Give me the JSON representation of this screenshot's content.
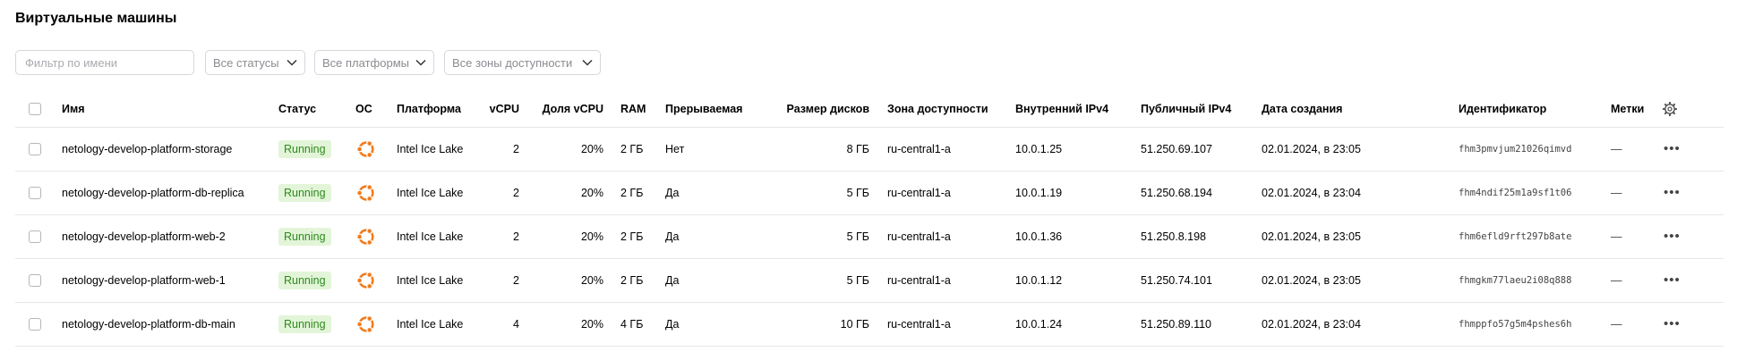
{
  "page": {
    "title": "Виртуальные машины"
  },
  "filters": {
    "name_placeholder": "Фильтр по имени",
    "status_value": "Все статусы",
    "platform_value": "Все платформы",
    "zone_value": "Все зоны доступности"
  },
  "table": {
    "columns": {
      "name": "Имя",
      "status": "Статус",
      "os": "ОС",
      "platform": "Платформа",
      "vcpu": "vCPU",
      "core_fraction": "Доля vCPU",
      "ram": "RAM",
      "preemptible": "Прерываемая",
      "disk_size": "Размер дисков",
      "zone": "Зона доступности",
      "internal_ip": "Внутренний IPv4",
      "public_ip": "Публичный IPv4",
      "created": "Дата создания",
      "id": "Идентификатор",
      "labels": "Метки"
    },
    "rows": [
      {
        "name": "netology-develop-platform-storage",
        "status": "Running",
        "os_icon": "ubuntu-icon",
        "platform": "Intel Ice Lake",
        "vcpu": "2",
        "core_fraction": "20%",
        "ram": "2 ГБ",
        "preemptible": "Нет",
        "disk_size": "8 ГБ",
        "zone": "ru-central1-a",
        "internal_ip": "10.0.1.25",
        "public_ip": "51.250.69.107",
        "created": "02.01.2024, в 23:05",
        "id": "fhm3pmvjum21026qimvd",
        "labels": "—"
      },
      {
        "name": "netology-develop-platform-db-replica",
        "status": "Running",
        "os_icon": "ubuntu-icon",
        "platform": "Intel Ice Lake",
        "vcpu": "2",
        "core_fraction": "20%",
        "ram": "2 ГБ",
        "preemptible": "Да",
        "disk_size": "5 ГБ",
        "zone": "ru-central1-a",
        "internal_ip": "10.0.1.19",
        "public_ip": "51.250.68.194",
        "created": "02.01.2024, в 23:04",
        "id": "fhm4ndif25m1a9sf1t06",
        "labels": "—"
      },
      {
        "name": "netology-develop-platform-web-2",
        "status": "Running",
        "os_icon": "ubuntu-icon",
        "platform": "Intel Ice Lake",
        "vcpu": "2",
        "core_fraction": "20%",
        "ram": "2 ГБ",
        "preemptible": "Да",
        "disk_size": "5 ГБ",
        "zone": "ru-central1-a",
        "internal_ip": "10.0.1.36",
        "public_ip": "51.250.8.198",
        "created": "02.01.2024, в 23:05",
        "id": "fhm6efld9rft297b8ate",
        "labels": "—"
      },
      {
        "name": "netology-develop-platform-web-1",
        "status": "Running",
        "os_icon": "ubuntu-icon",
        "platform": "Intel Ice Lake",
        "vcpu": "2",
        "core_fraction": "20%",
        "ram": "2 ГБ",
        "preemptible": "Да",
        "disk_size": "5 ГБ",
        "zone": "ru-central1-a",
        "internal_ip": "10.0.1.12",
        "public_ip": "51.250.74.101",
        "created": "02.01.2024, в 23:05",
        "id": "fhmgkm77laeu2i08q888",
        "labels": "—"
      },
      {
        "name": "netology-develop-platform-db-main",
        "status": "Running",
        "os_icon": "ubuntu-icon",
        "platform": "Intel Ice Lake",
        "vcpu": "4",
        "core_fraction": "20%",
        "ram": "4 ГБ",
        "preemptible": "Да",
        "disk_size": "10 ГБ",
        "zone": "ru-central1-a",
        "internal_ip": "10.0.1.24",
        "public_ip": "51.250.89.110",
        "created": "02.01.2024, в 23:04",
        "id": "fhmppfo57g5m4pshes6h",
        "labels": "—"
      }
    ]
  },
  "colors": {
    "status_running_bg": "#e3f5d8",
    "status_running_text": "#2d8a1e",
    "os_icon": "#f07c1e"
  }
}
